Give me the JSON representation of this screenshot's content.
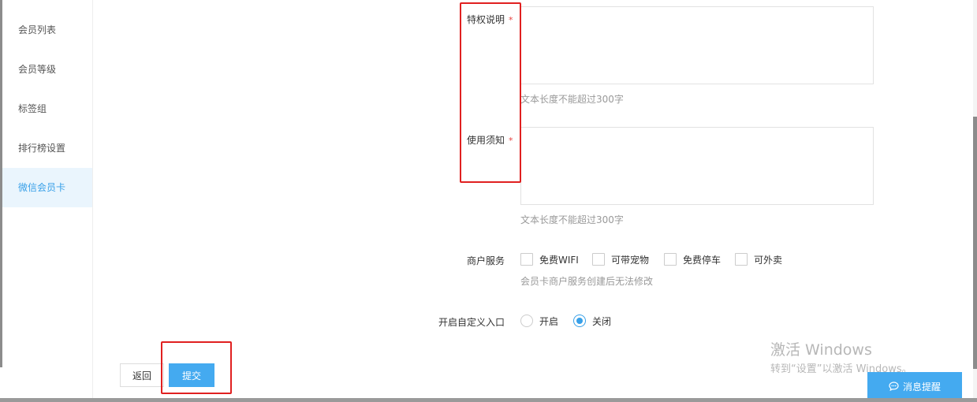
{
  "sidebar": {
    "items": [
      {
        "label": "会员列表"
      },
      {
        "label": "会员等级"
      },
      {
        "label": "标签组"
      },
      {
        "label": "排行榜设置"
      },
      {
        "label": "微信会员卡",
        "active": true
      }
    ]
  },
  "form": {
    "privilege": {
      "label": "特权说明",
      "required_mark": "*",
      "value": "",
      "hint": "文本长度不能超过300字"
    },
    "notice": {
      "label": "使用须知",
      "required_mark": "*",
      "value": "",
      "hint": "文本长度不能超过300字"
    },
    "merchant_service": {
      "label": "商户服务",
      "options": [
        {
          "label": "免费WIFI",
          "checked": false
        },
        {
          "label": "可带宠物",
          "checked": false
        },
        {
          "label": "免费停车",
          "checked": false
        },
        {
          "label": "可外卖",
          "checked": false
        }
      ],
      "hint": "会员卡商户服务创建后无法修改"
    },
    "custom_entry": {
      "label": "开启自定义入口",
      "options": [
        {
          "label": "开启",
          "selected": false
        },
        {
          "label": "关闭",
          "selected": true
        }
      ]
    }
  },
  "actions": {
    "back_label": "返回",
    "submit_label": "提交"
  },
  "watermark": {
    "title": "激活 Windows",
    "subtitle": "转到“设置”以激活 Windows。"
  },
  "message_button": {
    "label": "消息提醒",
    "icon": "chat-bubble-icon"
  },
  "colors": {
    "accent": "#44aaf0",
    "active_sidebar_bg": "#eaf5fd",
    "annotation_red": "#e02020",
    "required": "#e64340"
  }
}
